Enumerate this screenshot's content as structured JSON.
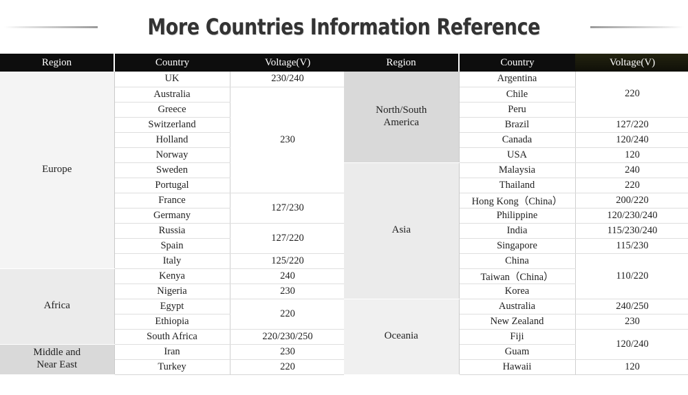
{
  "title": "More Countries Information Reference",
  "decor": {
    "rule_left": "gradient-rule-left",
    "rule_right": "gradient-rule-right"
  },
  "colors": {
    "header_bg": "#0d0d0d",
    "header_accent_bg": "#19190d",
    "header_text": "#ffffff",
    "title_text": "#333333",
    "cell_text": "#212121",
    "region_shade_1": "#f4f4f4",
    "region_shade_2": "#ebebeb",
    "region_shade_3": "#d9d9d9",
    "region_shade_4": "#f0f0f0",
    "grid_line": "#dedede"
  },
  "columns": {
    "region": "Region",
    "country": "Country",
    "voltage": "Voltage(V)"
  },
  "left_table": {
    "headers": [
      "Region",
      "Country",
      "Voltage(V)"
    ],
    "regions": [
      {
        "name": "Europe",
        "rowspan": 13,
        "shade": "#f4f4f4"
      },
      {
        "name": "Africa",
        "rowspan": 5,
        "shade": "#ebebeb"
      },
      {
        "name": "Middle and\nNear East",
        "rowspan": 2,
        "shade": "#d9d9d9"
      }
    ],
    "rows": [
      {
        "country": "UK",
        "voltage": "230/240",
        "vspan": 1
      },
      {
        "country": "Australia",
        "voltage": "230",
        "vspan": 7
      },
      {
        "country": "Greece",
        "voltage": null
      },
      {
        "country": "Switzerland",
        "voltage": null
      },
      {
        "country": "Holland",
        "voltage": null
      },
      {
        "country": "Norway",
        "voltage": null
      },
      {
        "country": "Sweden",
        "voltage": null
      },
      {
        "country": "Portugal",
        "voltage": null
      },
      {
        "country": "France",
        "voltage": "127/230",
        "vspan": 2
      },
      {
        "country": "Germany",
        "voltage": null
      },
      {
        "country": "Russia",
        "voltage": "127/220",
        "vspan": 2
      },
      {
        "country": "Spain",
        "voltage": null
      },
      {
        "country": "Italy",
        "voltage": "125/220",
        "vspan": 1
      },
      {
        "country": "Kenya",
        "voltage": "240",
        "vspan": 1
      },
      {
        "country": "Nigeria",
        "voltage": "230",
        "vspan": 1
      },
      {
        "country": "Egypt",
        "voltage": "220",
        "vspan": 2
      },
      {
        "country": "Ethiopia",
        "voltage": null
      },
      {
        "country": "South Africa",
        "voltage": "220/230/250",
        "vspan": 1
      },
      {
        "country": "Iran",
        "voltage": "230",
        "vspan": 1
      },
      {
        "country": "Turkey",
        "voltage": "220",
        "vspan": 1
      }
    ]
  },
  "right_table": {
    "headers": [
      "Region",
      "Country",
      "Voltage(V)"
    ],
    "regions": [
      {
        "name": "North/South\nAmerica",
        "rowspan": 6,
        "shade": "#d9d9d9"
      },
      {
        "name": "Asia",
        "rowspan": 9,
        "shade": "#ebebeb"
      },
      {
        "name": "Oceania",
        "rowspan": 5,
        "shade": "#f0f0f0"
      }
    ],
    "rows": [
      {
        "country": "Argentina",
        "voltage": "220",
        "vspan": 3
      },
      {
        "country": "Chile",
        "voltage": null
      },
      {
        "country": "Peru",
        "voltage": null
      },
      {
        "country": "Brazil",
        "voltage": "127/220",
        "vspan": 1
      },
      {
        "country": "Canada",
        "voltage": "120/240",
        "vspan": 1
      },
      {
        "country": "USA",
        "voltage": "120",
        "vspan": 1
      },
      {
        "country": "Malaysia",
        "voltage": "240",
        "vspan": 1
      },
      {
        "country": "Thailand",
        "voltage": "220",
        "vspan": 1
      },
      {
        "country": "Hong Kong（China）",
        "voltage": "200/220",
        "vspan": 1
      },
      {
        "country": "Philippine",
        "voltage": "120/230/240",
        "vspan": 1
      },
      {
        "country": "India",
        "voltage": "115/230/240",
        "vspan": 1
      },
      {
        "country": "Singapore",
        "voltage": "115/230",
        "vspan": 1
      },
      {
        "country": "China",
        "voltage": "110/220",
        "vspan": 3
      },
      {
        "country": "Taiwan（China）",
        "voltage": null
      },
      {
        "country": "Korea",
        "voltage": null
      },
      {
        "country": "Australia",
        "voltage": "240/250",
        "vspan": 1
      },
      {
        "country": "New Zealand",
        "voltage": "230",
        "vspan": 1
      },
      {
        "country": "Fiji",
        "voltage": "120/240",
        "vspan": 2
      },
      {
        "country": "Guam",
        "voltage": null
      },
      {
        "country": "Hawaii",
        "voltage": "120",
        "vspan": 1
      }
    ]
  }
}
